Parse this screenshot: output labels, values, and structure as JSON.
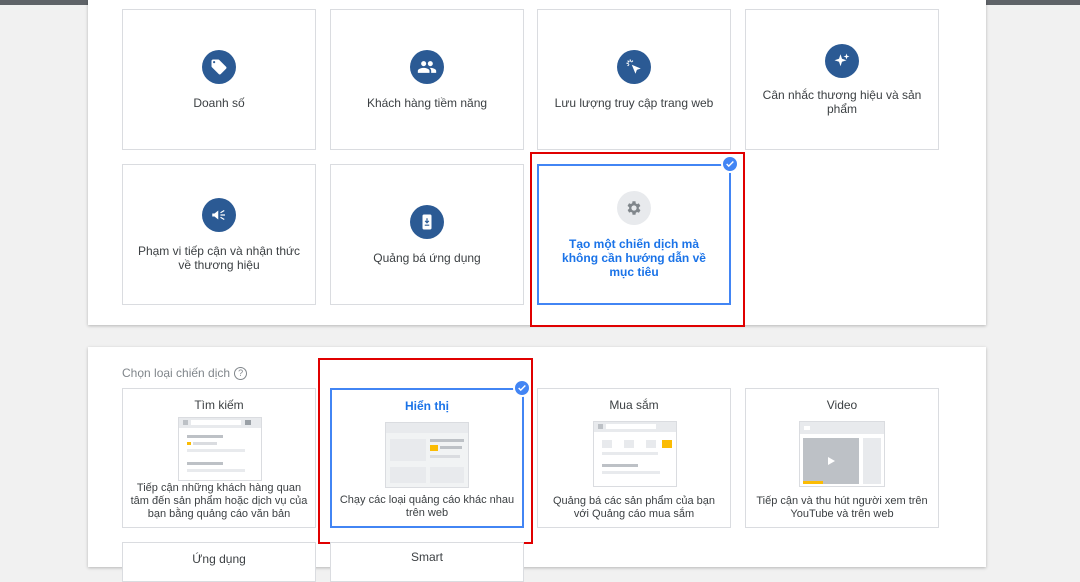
{
  "goals": [
    {
      "label": "Doanh số",
      "icon": "tag-icon"
    },
    {
      "label": "Khách hàng tiềm năng",
      "icon": "people-icon"
    },
    {
      "label": "Lưu lượng truy cập trang web",
      "icon": "cursor-click-icon"
    },
    {
      "label": "Cân nhắc thương hiệu và sản phẩm",
      "icon": "sparkle-icon"
    },
    {
      "label": "Phạm vi tiếp cận và nhận thức về thương hiệu",
      "icon": "megaphone-icon"
    },
    {
      "label": "Quảng bá ứng dụng",
      "icon": "phone-download-icon"
    },
    {
      "label": "Tạo một chiến dịch mà không cần hướng dẫn về mục tiêu",
      "icon": "gear-icon",
      "selected": true
    }
  ],
  "campaign_type_section": {
    "title": "Chọn loại chiến dịch",
    "help_icon": "help-circle-icon"
  },
  "campaign_types": [
    {
      "title": "Tìm kiếm",
      "desc": "Tiếp cận những khách hàng quan tâm đến sản phẩm hoặc dịch vụ của bạn bằng quảng cáo văn bản"
    },
    {
      "title": "Hiển thị",
      "desc": "Chạy các loại quảng cáo khác nhau trên web",
      "selected": true
    },
    {
      "title": "Mua sắm",
      "desc": "Quảng bá các sản phẩm của bạn với Quảng cáo mua sắm"
    },
    {
      "title": "Video",
      "desc": "Tiếp cận và thu hút người xem trên YouTube và trên web"
    },
    {
      "title": "Ứng dụng"
    },
    {
      "title": "Smart"
    }
  ],
  "colors": {
    "accent": "#4285f4",
    "icon_bg": "#2b5a94",
    "highlight": "#e00000",
    "selected_text": "#1a73e8",
    "illus_yellow": "#fbbc04"
  }
}
